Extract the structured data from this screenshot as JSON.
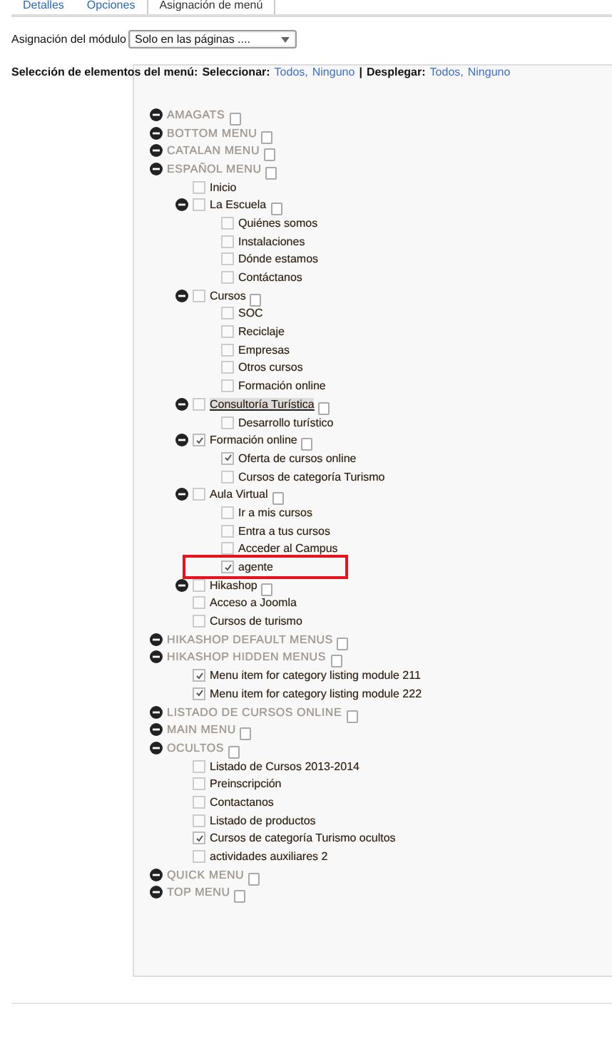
{
  "tabs": [
    {
      "label": "Detalles",
      "selected": false
    },
    {
      "label": "Opciones",
      "selected": false
    },
    {
      "label": "Asignación de menú",
      "selected": true
    }
  ],
  "assignment": {
    "label": "Asignación del módulo",
    "value": "Solo en las páginas ...."
  },
  "selection": {
    "label": "Selección de elementos del menú:",
    "select_label": "Seleccionar:",
    "select_all": "Todos,",
    "select_none": "Ninguno",
    "separator": "|",
    "expand_label": "Desplegar:",
    "expand_all": "Todos,",
    "expand_none": "Ninguno"
  },
  "menus": [
    {
      "title": "AMAGATS"
    },
    {
      "title": "BOTTOM MENU"
    },
    {
      "title": "CATALAN MENU"
    },
    {
      "title": "ESPAÑOL MENU",
      "children": [
        {
          "kind": "item",
          "label": "Inicio",
          "checked": false
        },
        {
          "kind": "folder",
          "label": "La Escuela",
          "checked": false,
          "children": [
            {
              "label": "Quiénes somos",
              "checked": false
            },
            {
              "label": "Instalaciones",
              "checked": false
            },
            {
              "label": "Dónde estamos",
              "checked": false
            },
            {
              "label": "Contáctanos",
              "checked": false
            }
          ]
        },
        {
          "kind": "folder",
          "label": "Cursos",
          "checked": false,
          "children": [
            {
              "label": "SOC",
              "checked": false
            },
            {
              "label": "Reciclaje",
              "checked": false
            },
            {
              "label": "Empresas",
              "checked": false
            },
            {
              "label": "Otros cursos",
              "checked": false
            },
            {
              "label": "Formación online",
              "checked": false
            }
          ]
        },
        {
          "kind": "folder",
          "label": "Consultoría Turística",
          "checked": false,
          "highlighted": true,
          "children": [
            {
              "label": "Desarrollo turístico",
              "checked": false
            }
          ]
        },
        {
          "kind": "folder",
          "label": "Formación online",
          "checked": true,
          "children": [
            {
              "label": "Oferta de cursos online",
              "checked": true
            },
            {
              "label": "Cursos de categoría Turismo",
              "checked": false
            }
          ]
        },
        {
          "kind": "folder",
          "label": "Aula Virtual",
          "checked": false,
          "children": [
            {
              "label": "Ir a mis cursos",
              "checked": false
            },
            {
              "label": "Entra a tus cursos",
              "checked": false
            },
            {
              "label": "Acceder al Campus",
              "checked": false
            },
            {
              "label": "agente",
              "checked": true,
              "marked": true
            }
          ]
        },
        {
          "kind": "folder",
          "label": "Hikashop",
          "checked": false
        },
        {
          "kind": "item",
          "label": "Acceso a Joomla",
          "checked": false
        },
        {
          "kind": "item",
          "label": "Cursos de turismo",
          "checked": false
        }
      ]
    },
    {
      "title": "HIKASHOP DEFAULT MENUS"
    },
    {
      "title": "HIKASHOP HIDDEN MENUS",
      "children": [
        {
          "kind": "item",
          "label": "Menu item for category listing module 211",
          "checked": true
        },
        {
          "kind": "item",
          "label": "Menu item for category listing module 222",
          "checked": true
        }
      ]
    },
    {
      "title": "LISTADO DE CURSOS ONLINE"
    },
    {
      "title": "MAIN MENU"
    },
    {
      "title": "OCULTOS",
      "children": [
        {
          "kind": "item",
          "label": "Listado de Cursos 2013-2014",
          "checked": false
        },
        {
          "kind": "item",
          "label": "Preinscripción",
          "checked": false
        },
        {
          "kind": "item",
          "label": "Contactanos",
          "checked": false
        },
        {
          "kind": "item",
          "label": "Listado de productos",
          "checked": false
        },
        {
          "kind": "item",
          "label": "Cursos de categoría Turismo ocultos",
          "checked": true
        },
        {
          "kind": "item",
          "label": "actividades auxiliares 2",
          "checked": false
        }
      ]
    },
    {
      "title": "QUICK MENU"
    },
    {
      "title": "TOP MENU"
    }
  ]
}
